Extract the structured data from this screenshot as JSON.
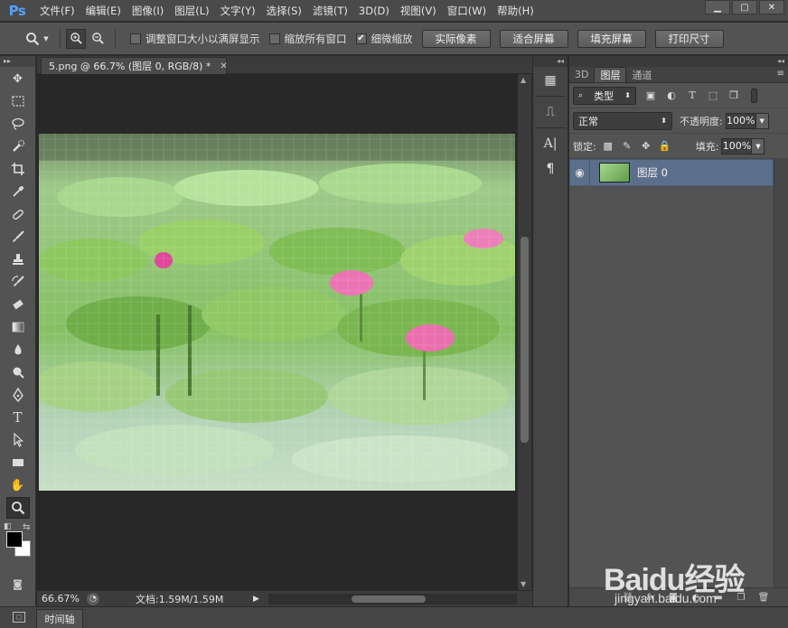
{
  "app": {
    "logo": "Ps",
    "menus": [
      "文件(F)",
      "编辑(E)",
      "图像(I)",
      "图层(L)",
      "文字(Y)",
      "选择(S)",
      "滤镜(T)",
      "3D(D)",
      "视图(V)",
      "窗口(W)",
      "帮助(H)"
    ],
    "window_controls": [
      "minimize-icon",
      "maximize-icon",
      "close-icon"
    ]
  },
  "options": {
    "tool_icon": "zoom-icon",
    "zoom_in_icon": "zoom-in-icon",
    "zoom_out_icon": "zoom-out-icon",
    "resize_windows": {
      "label": "调整窗口大小以满屏显示",
      "checked": false
    },
    "zoom_all_windows": {
      "label": "缩放所有窗口",
      "checked": false
    },
    "scrubby_zoom": {
      "label": "细微缩放",
      "checked": true
    },
    "buttons": [
      "实际像素",
      "适合屏幕",
      "填充屏幕",
      "打印尺寸"
    ]
  },
  "document": {
    "tab_title": "5.png @ 66.7% (图层 0, RGB/8) *",
    "zoom": "66.67%",
    "doc_info": "文档:1.59M/1.59M"
  },
  "timeline": {
    "tab": "时间轴"
  },
  "layers_panel": {
    "tabs": [
      "3D",
      "图层",
      "通道"
    ],
    "active_tab": "图层",
    "filter_kind": "类型",
    "blend_mode": "正常",
    "opacity_label": "不透明度:",
    "opacity": "100%",
    "lock_label": "锁定:",
    "fill_label": "填充:",
    "fill": "100%",
    "layers": [
      {
        "name": "图层 0",
        "visible": true,
        "selected": true
      }
    ]
  },
  "watermark": {
    "text": "Baidu经验",
    "sub": "jingyan.baidu.com"
  },
  "colors": {
    "accent": "#4fa3ff",
    "selected_layer": "#5c6f8a",
    "ui_bg": "#535353",
    "canvas_bg": "#282828"
  }
}
